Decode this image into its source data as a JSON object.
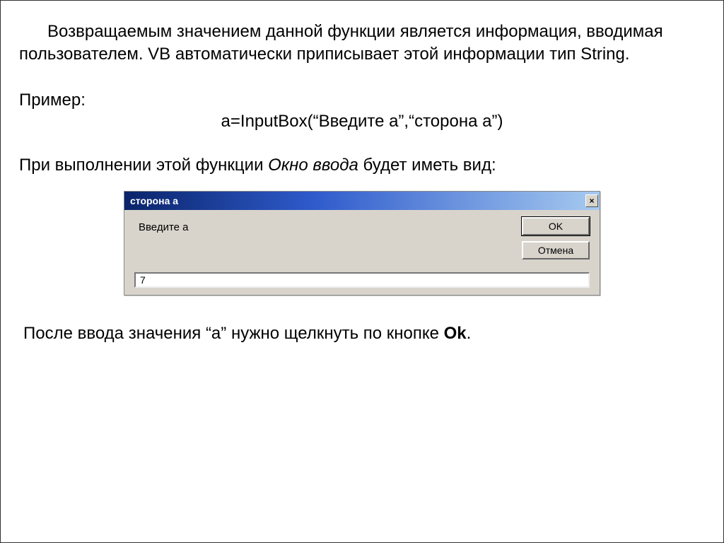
{
  "text": {
    "p1": "Возвращаемым значением данной функции является информация, вводимая пользователем. VB автоматически приписывает этой информации тип String.",
    "example_label": "Пример:",
    "code": "a=InputBox(“Введите a”,“сторона a”)",
    "p3_before": "При выполнении этой функции ",
    "p3_italic": "Окно ввода",
    "p3_after": " будет иметь вид:",
    "p_after_before": "После ввода значения “a” нужно щелкнуть по кнопке ",
    "p_after_bold": "Ok",
    "p_after_end": "."
  },
  "dialog": {
    "title": "сторона а",
    "prompt": "Введите а",
    "ok_label": "OK",
    "cancel_label": "Отмена",
    "input_value": "7",
    "close_glyph": "×"
  }
}
